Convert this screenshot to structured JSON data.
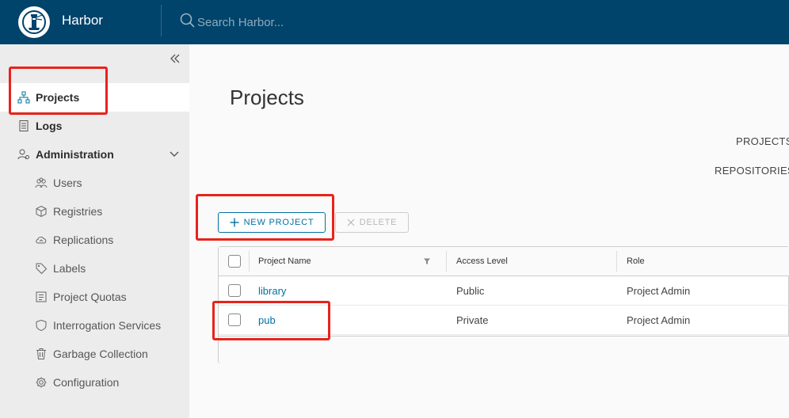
{
  "header": {
    "brand": "Harbor",
    "search_placeholder": "Search Harbor..."
  },
  "sidebar": {
    "items": [
      {
        "label": "Projects",
        "icon": "projects-icon"
      },
      {
        "label": "Logs",
        "icon": "logs-icon"
      },
      {
        "label": "Administration",
        "icon": "administration-icon"
      }
    ],
    "admin_items": [
      {
        "label": "Users",
        "icon": "users-icon"
      },
      {
        "label": "Registries",
        "icon": "registries-icon"
      },
      {
        "label": "Replications",
        "icon": "replications-icon"
      },
      {
        "label": "Labels",
        "icon": "labels-icon"
      },
      {
        "label": "Project Quotas",
        "icon": "quotas-icon"
      },
      {
        "label": "Interrogation Services",
        "icon": "shield-icon"
      },
      {
        "label": "Garbage Collection",
        "icon": "trash-icon"
      },
      {
        "label": "Configuration",
        "icon": "gear-icon"
      }
    ]
  },
  "main": {
    "title": "Projects",
    "stats": {
      "projects": "PROJECTS",
      "repositories": "REPOSITORIES"
    },
    "new_project": "NEW PROJECT",
    "delete": "DELETE",
    "columns": [
      "Project Name",
      "Access Level",
      "Role"
    ],
    "rows": [
      {
        "name": "library",
        "access": "Public",
        "role": "Project Admin"
      },
      {
        "name": "pub",
        "access": "Private",
        "role": "Project Admin"
      }
    ]
  },
  "colors": {
    "header": "#00436b",
    "accent": "#0072a3",
    "annotation": "#e8231c"
  }
}
